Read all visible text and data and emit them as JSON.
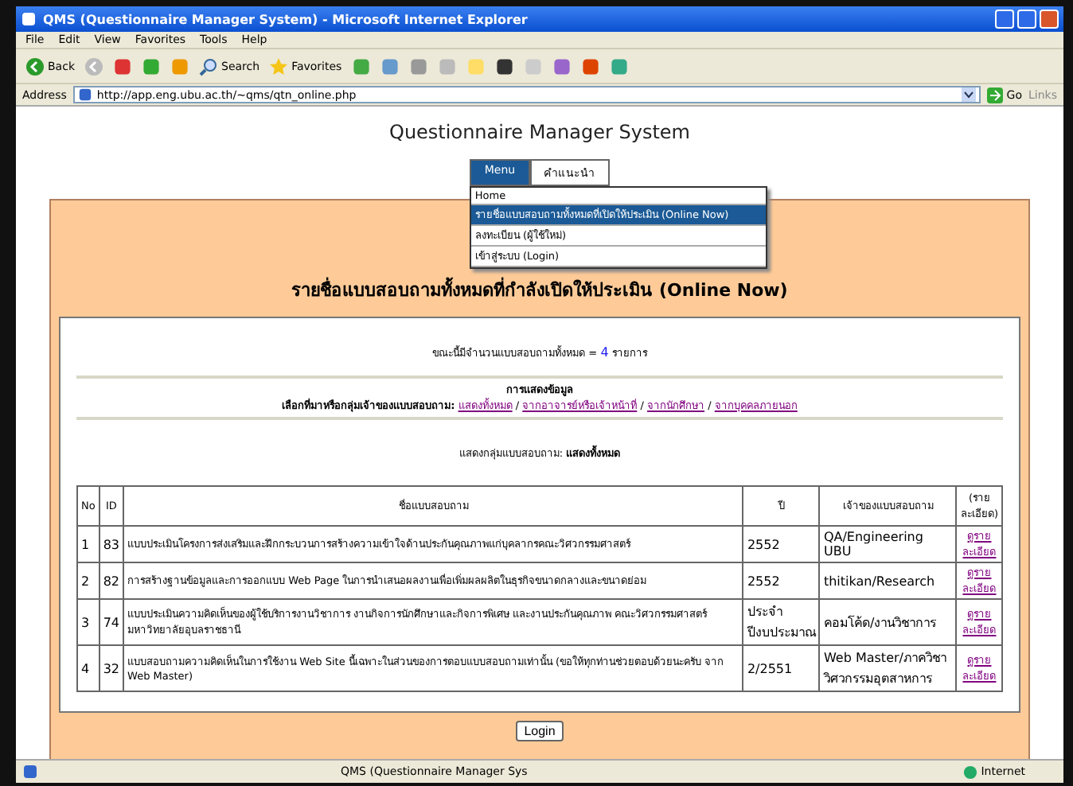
{
  "window": {
    "title": "QMS (Questionnaire Manager System) - Microsoft Internet Explorer"
  },
  "menubar": [
    "File",
    "Edit",
    "View",
    "Favorites",
    "Tools",
    "Help"
  ],
  "toolbar": {
    "back": "Back",
    "search": "Search",
    "favorites": "Favorites"
  },
  "address": {
    "label": "Address",
    "url": "http://app.eng.ubu.ac.th/~qms/qtn_online.php",
    "go": "Go",
    "links": "Links"
  },
  "page": {
    "site_title": "Questionnaire Manager System",
    "tabs": [
      {
        "label": "Menu",
        "selected": true
      },
      {
        "label": "คำแนะนำ",
        "selected": false
      }
    ],
    "menu_items": [
      {
        "label": "Home",
        "selected": false
      },
      {
        "label": "รายชื่อแบบสอบถามทั้งหมดที่เปิดให้ประเมิน (Online Now)",
        "selected": true
      },
      {
        "label": "ลงทะเบียน (ผู้ใช้ใหม่)",
        "selected": false
      },
      {
        "label": "เข้าสู่ระบบ (Login)",
        "selected": false
      }
    ],
    "heading": "รายชื่อแบบสอบถามทั้งหมดที่กำลังเปิดให้ประเมิน (Online Now)",
    "count_text": "ขณะนี้มีจำนวนแบบสอบถามทั้งหมด =",
    "count": "4",
    "count_unit": "รายการ",
    "filter_title": "การแสดงข้อมูล",
    "filter_label": "เลือกที่มาหรือกลุ่มเจ้าของแบบสอบถาม:",
    "filter_separator": "/",
    "filter_links": [
      "แสดงทั้งหมด",
      "จากอาจารย์หรือเจ้าหน้าที่",
      "จากนักศึกษา",
      "จากบุคคลภายนอก"
    ],
    "group_label": "แสดงกลุ่มแบบสอบถาม:",
    "group_value": "แสดงทั้งหมด",
    "table": {
      "columns": [
        "No",
        "ID",
        "ชื่อแบบสอบถาม",
        "ปี",
        "เจ้าของแบบสอบถาม",
        "(ราย ละเอียด)"
      ],
      "rows": [
        {
          "no": "1",
          "id": "83",
          "name": "แบบประเมินโครงการส่งเสริมและฝึกกระบวนการสร้างความเข้าใจด้านประกันคุณภาพแก่บุคลากรคณะวิศวกรรมศาสตร์",
          "year": "2552",
          "owner": "QA/Engineering UBU",
          "detail": "ดูราย ละเอียด"
        },
        {
          "no": "2",
          "id": "82",
          "name": "การสร้างฐานข้อมูลและการออกแบบ Web Page ในการนำเสนอผลงานเพื่อเพิ่มผลผลิตในธุรกิจขนาดกลางและขนาดย่อม",
          "year": "2552",
          "owner": "thitikan/Research",
          "detail": "ดูราย ละเอียด"
        },
        {
          "no": "3",
          "id": "74",
          "name": "แบบประเมินความคิดเห็นของผู้ใช้บริการงานวิชาการ งานกิจการนักศึกษาและกิจการพิเศษ และงานประกันคุณภาพ คณะวิศวกรรมศาสตร์ มหาวิทยาลัยอุบลราชธานี",
          "year": "ประจำปีงบประมาณ",
          "owner": "คอมโค้ด/งานวิชาการ",
          "detail": "ดูราย ละเอียด"
        },
        {
          "no": "4",
          "id": "32",
          "name": "แบบสอบถามความคิดเห็นในการใช้งาน Web Site นี้เฉพาะในส่วนของการตอบแบบสอบถามเท่านั้น (ขอให้ทุกท่านช่วยตอบด้วยนะครับ จาก Web Master)",
          "year": "2/2551",
          "owner": "Web Master/ภาควิชาวิศวกรรมอุตสาหการ",
          "detail": "ดูราย ละเอียด"
        }
      ]
    },
    "login_button": "Login"
  },
  "status_bar": {
    "text": "QMS (Questionnaire Manager Sys",
    "zone": "Internet"
  }
}
